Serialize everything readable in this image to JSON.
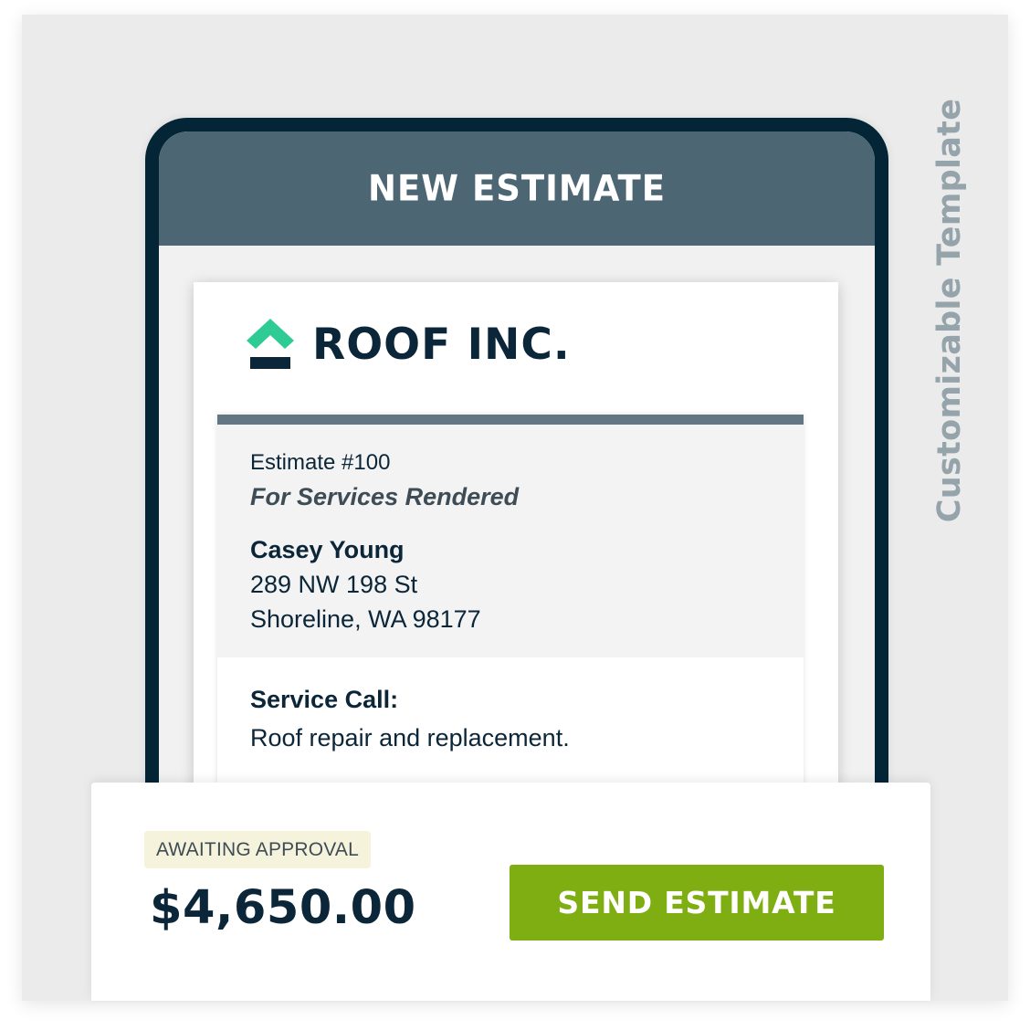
{
  "side_label": "Customizable Template",
  "screen": {
    "title": "NEW ESTIMATE"
  },
  "brand": {
    "name": "ROOF INC.",
    "icon": "roof-logo-icon",
    "colors": {
      "roof": "#2ecc94",
      "base": "#0b2638"
    }
  },
  "estimate": {
    "number": "Estimate #100",
    "subtitle": "For Services Rendered",
    "client": {
      "name": "Casey Young",
      "address_line1": "289 NW 198 St",
      "address_line2": "Shoreline, WA 98177"
    },
    "service": {
      "label": "Service Call:",
      "description": "Roof repair and replacement."
    }
  },
  "footer": {
    "status": "AWAITING APPROVAL",
    "amount": "$4,650.00",
    "send_button": "SEND ESTIMATE"
  },
  "colors": {
    "phone_frame": "#032536",
    "header": "#4d6673",
    "accent_green": "#7fae12",
    "badge_bg": "#f6f3dc"
  }
}
